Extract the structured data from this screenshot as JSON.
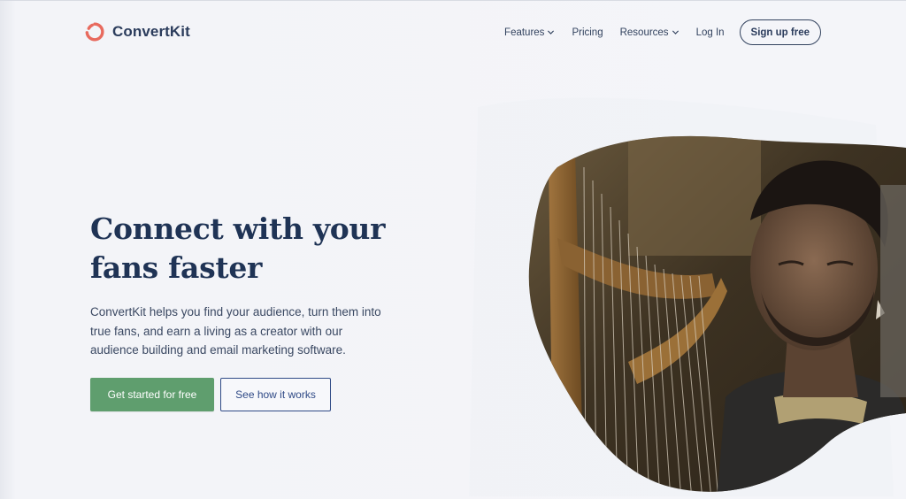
{
  "brand": {
    "name": "ConvertKit",
    "logo_icon": "convertkit-logo-icon",
    "logo_color": "#e86a5e"
  },
  "nav": {
    "items": [
      {
        "label": "Features",
        "has_dropdown": true
      },
      {
        "label": "Pricing",
        "has_dropdown": false
      },
      {
        "label": "Resources",
        "has_dropdown": true
      },
      {
        "label": "Log In",
        "has_dropdown": false
      }
    ],
    "signup_label": "Sign up free"
  },
  "hero": {
    "title": "Connect with your fans faster",
    "subtitle": "ConvertKit helps you find your audience, turn them into true fans, and earn a living as a creator with our audience building and email marketing software.",
    "primary_cta": "Get started for free",
    "secondary_cta": "See how it works",
    "image": "harpist-video-blob"
  },
  "colors": {
    "background": "#f4f5f9",
    "navy": "#1f3355",
    "green": "#5f9e6e",
    "accent_blue": "#2f4a86"
  }
}
